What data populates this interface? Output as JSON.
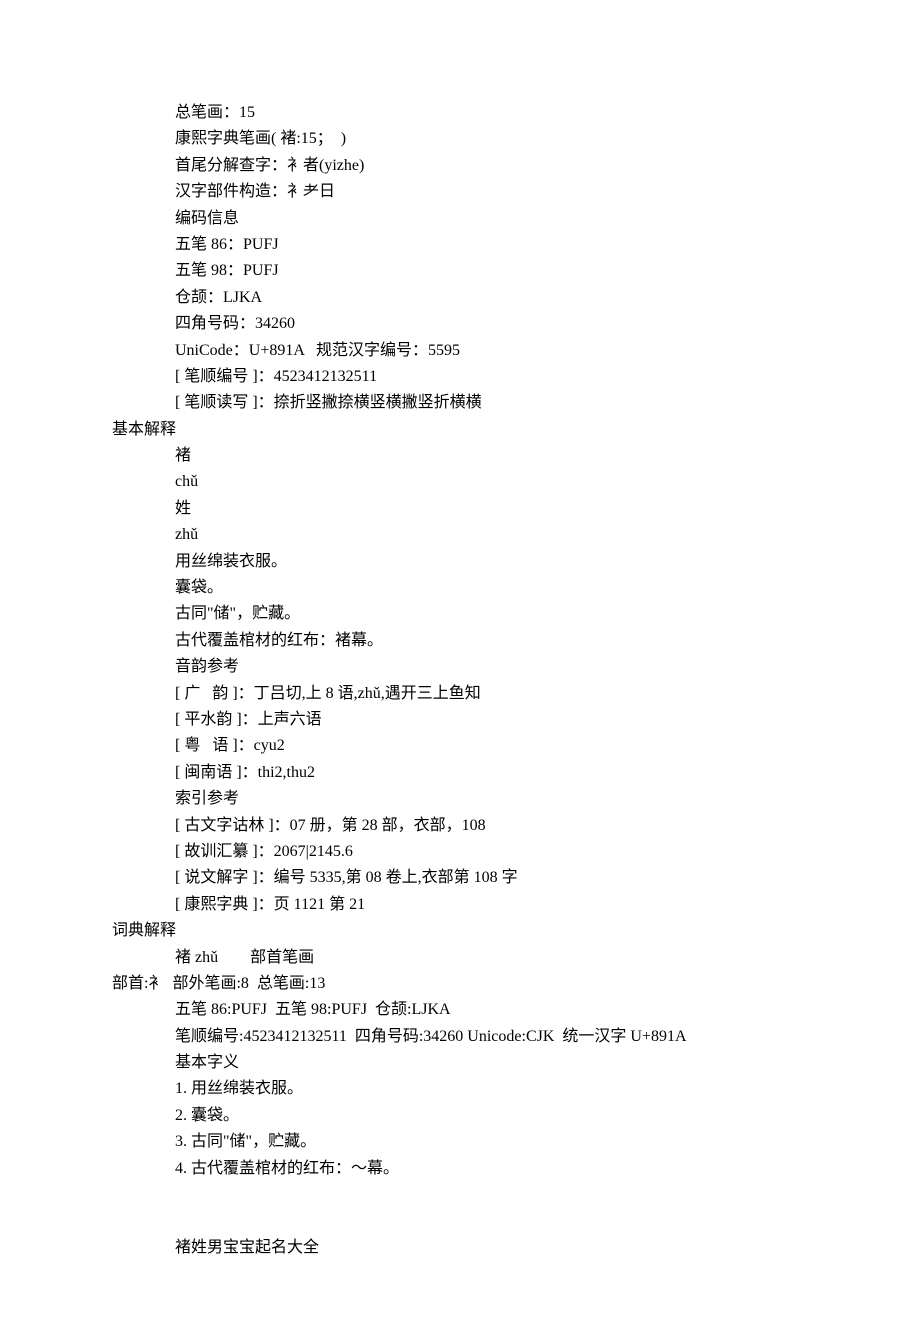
{
  "lines": [
    {
      "indent": 1,
      "text": "总笔画：15"
    },
    {
      "indent": 1,
      "text": "康熙字典笔画( 褚:15；  )"
    },
    {
      "indent": 1,
      "text": "首尾分解查字：衤者(yizhe)"
    },
    {
      "indent": 1,
      "text": "汉字部件构造：衤耂日"
    },
    {
      "indent": 1,
      "text": "编码信息"
    },
    {
      "indent": 1,
      "text": "五笔 86：PUFJ"
    },
    {
      "indent": 1,
      "text": "五笔 98：PUFJ"
    },
    {
      "indent": 1,
      "text": "仓颉：LJKA"
    },
    {
      "indent": 1,
      "text": "四角号码：34260"
    },
    {
      "indent": 1,
      "text": "UniCode：U+891A   规范汉字编号：5595"
    },
    {
      "indent": 1,
      "text": "[ 笔顺编号 ]：4523412132511"
    },
    {
      "indent": 1,
      "text": "[ 笔顺读写 ]：捺折竖撇捺横竖横撇竖折横横"
    },
    {
      "indent": 0,
      "text": "基本解释"
    },
    {
      "indent": 1,
      "text": "褚"
    },
    {
      "indent": 1,
      "text": "chǔ"
    },
    {
      "indent": 1,
      "text": "姓"
    },
    {
      "indent": 1,
      "text": "zhǔ"
    },
    {
      "indent": 1,
      "text": "用丝绵装衣服。"
    },
    {
      "indent": 1,
      "text": "囊袋。"
    },
    {
      "indent": 1,
      "text": "古同\"储\"，贮藏。"
    },
    {
      "indent": 1,
      "text": "古代覆盖棺材的红布：褚幕。"
    },
    {
      "indent": 1,
      "text": "音韵参考"
    },
    {
      "indent": 1,
      "text": "[ 广   韵 ]：丁吕切,上 8 语,zhǔ,遇开三上鱼知"
    },
    {
      "indent": 1,
      "text": "[ 平水韵 ]：上声六语"
    },
    {
      "indent": 1,
      "text": "[ 粤   语 ]：cyu2"
    },
    {
      "indent": 1,
      "text": "[ 闽南语 ]：thi2,thu2"
    },
    {
      "indent": 1,
      "text": "索引参考"
    },
    {
      "indent": 1,
      "text": "[ 古文字诂林 ]：07 册，第 28 部，衣部，108"
    },
    {
      "indent": 1,
      "text": "[ 故训汇纂 ]：2067|2145.6"
    },
    {
      "indent": 1,
      "text": "[ 说文解字 ]：编号 5335,第 08 卷上,衣部第 108 字"
    },
    {
      "indent": 1,
      "text": "[ 康熙字典 ]：页 1121 第 21"
    },
    {
      "indent": 0,
      "text": "词典解释"
    },
    {
      "indent": 1,
      "text": "褚 zhǔ        部首笔画"
    },
    {
      "indent": 0,
      "text": "部首:衤  部外笔画:8  总笔画:13"
    },
    {
      "indent": 1,
      "text": "五笔 86:PUFJ  五笔 98:PUFJ  仓颉:LJKA"
    },
    {
      "indent": 1,
      "text": "笔顺编号:4523412132511  四角号码:34260 Unicode:CJK  统一汉字 U+891A"
    },
    {
      "indent": 1,
      "text": "基本字义"
    },
    {
      "indent": 1,
      "text": "1. 用丝绵装衣服。"
    },
    {
      "indent": 1,
      "text": "2. 囊袋。"
    },
    {
      "indent": 1,
      "text": "3. 古同\"储\"，贮藏。"
    },
    {
      "indent": 1,
      "text": "4. 古代覆盖棺材的红布：～幕。"
    },
    {
      "indent": 1,
      "text": ""
    },
    {
      "indent": 1,
      "text": ""
    },
    {
      "indent": 1,
      "text": "褚姓男宝宝起名大全"
    }
  ]
}
